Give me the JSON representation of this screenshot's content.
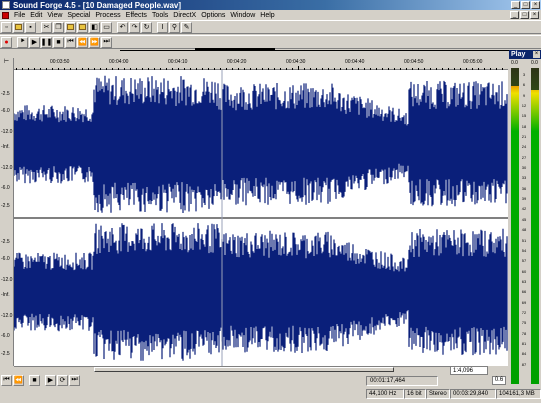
{
  "app": {
    "title": "Sound Forge 4.5 - [10 Damaged People.wav]"
  },
  "window_buttons": [
    "_",
    "□",
    "×"
  ],
  "menu": [
    "File",
    "Edit",
    "View",
    "Special",
    "Process",
    "Effects",
    "Tools",
    "DirectX",
    "Options",
    "Window",
    "Help"
  ],
  "ruler": {
    "corner": "⊢",
    "labels": [
      "00:03:50",
      "00:04:00",
      "00:04:10",
      "00:04:20",
      "00:04:30",
      "00:04:40",
      "00:04:50",
      "00:05:00"
    ]
  },
  "amplitude_scale_top": [
    "-2.5",
    "-6.0",
    "-12.0",
    "-Inf.",
    "-12.0",
    "-6.0",
    "-2.5"
  ],
  "amplitude_scale_bottom": [
    "-2.5",
    "-6.0",
    "-12.0",
    "-Inf.",
    "-12.0",
    "-6.0",
    "-2.5"
  ],
  "zoom_ratio": "1:4,096",
  "zoom_button": "0.6",
  "cursor_time": "00:01:17,464",
  "status": {
    "sample_rate": "44,100 Hz",
    "bit_depth": "16 bit",
    "channels": "Stereo",
    "length": "00:03:29,840",
    "size": "104161,3 MB"
  },
  "play_meter": {
    "title": "Play",
    "close": "×",
    "peak_left": "0.0",
    "peak_right": "0.0",
    "db_labels": [
      "3",
      "6",
      "9",
      "12",
      "15",
      "18",
      "21",
      "24",
      "27",
      "30",
      "33",
      "36",
      "39",
      "42",
      "45",
      "48",
      "51",
      "54",
      "57",
      "60",
      "63",
      "66",
      "69",
      "72",
      "75",
      "78",
      "81",
      "84",
      "87"
    ]
  },
  "colors": {
    "waveform": "#0a1f7a",
    "background": "#ffffff",
    "titlebar": "#0a246a"
  }
}
